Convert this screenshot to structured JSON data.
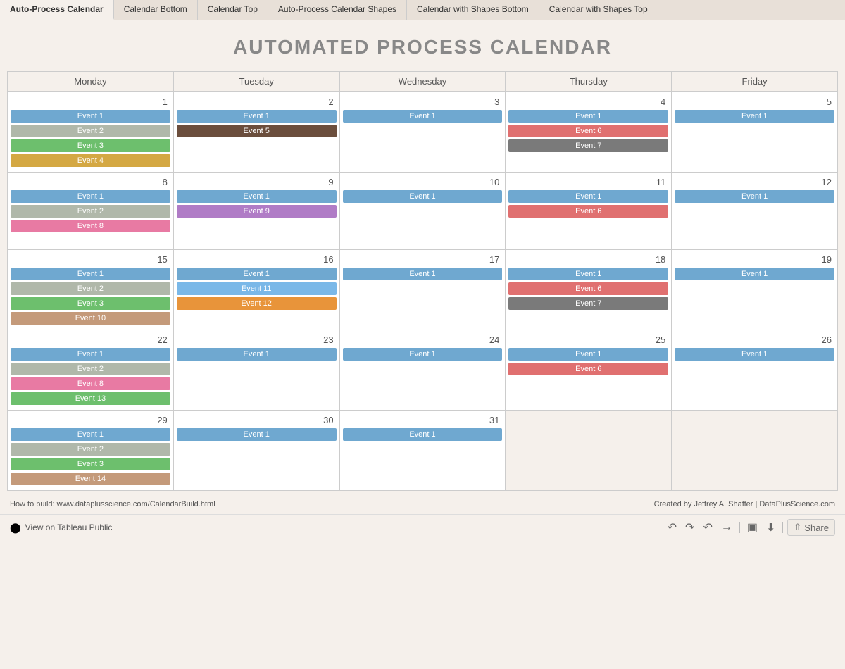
{
  "tabs": [
    {
      "label": "Auto-Process Calendar",
      "active": true
    },
    {
      "label": "Calendar Bottom",
      "active": false
    },
    {
      "label": "Calendar Top",
      "active": false
    },
    {
      "label": "Auto-Process Calendar Shapes",
      "active": false
    },
    {
      "label": "Calendar with Shapes Bottom",
      "active": false
    },
    {
      "label": "Calendar with Shapes Top",
      "active": false
    }
  ],
  "title": "AUTOMATED PROCESS CALENDAR",
  "day_headers": [
    "Monday",
    "Tuesday",
    "Wednesday",
    "Thursday",
    "Friday"
  ],
  "weeks": [
    {
      "days": [
        {
          "number": 1,
          "events": [
            {
              "label": "Event 1",
              "color": "#6fa8d0"
            },
            {
              "label": "Event 2",
              "color": "#b0b8aa"
            },
            {
              "label": "Event 3",
              "color": "#6dbf6d"
            },
            {
              "label": "Event 4",
              "color": "#d4a843"
            }
          ]
        },
        {
          "number": 2,
          "events": [
            {
              "label": "Event 1",
              "color": "#6fa8d0"
            },
            {
              "label": "Event 5",
              "color": "#6b4e3d"
            }
          ]
        },
        {
          "number": 3,
          "events": [
            {
              "label": "Event 1",
              "color": "#6fa8d0"
            }
          ]
        },
        {
          "number": 4,
          "events": [
            {
              "label": "Event 1",
              "color": "#6fa8d0"
            },
            {
              "label": "Event 6",
              "color": "#e07070"
            },
            {
              "label": "Event 7",
              "color": "#7a7a7a"
            }
          ]
        },
        {
          "number": 5,
          "events": [
            {
              "label": "Event 1",
              "color": "#6fa8d0"
            }
          ]
        }
      ]
    },
    {
      "days": [
        {
          "number": 8,
          "events": [
            {
              "label": "Event 1",
              "color": "#6fa8d0"
            },
            {
              "label": "Event 2",
              "color": "#b0b8aa"
            },
            {
              "label": "Event 8",
              "color": "#e87aa3"
            }
          ]
        },
        {
          "number": 9,
          "events": [
            {
              "label": "Event 1",
              "color": "#6fa8d0"
            },
            {
              "label": "Event 9",
              "color": "#b07cc6"
            }
          ]
        },
        {
          "number": 10,
          "events": [
            {
              "label": "Event 1",
              "color": "#6fa8d0"
            }
          ]
        },
        {
          "number": 11,
          "events": [
            {
              "label": "Event 1",
              "color": "#6fa8d0"
            },
            {
              "label": "Event 6",
              "color": "#e07070"
            }
          ]
        },
        {
          "number": 12,
          "events": [
            {
              "label": "Event 1",
              "color": "#6fa8d0"
            }
          ]
        }
      ]
    },
    {
      "days": [
        {
          "number": 15,
          "events": [
            {
              "label": "Event 1",
              "color": "#6fa8d0"
            },
            {
              "label": "Event 2",
              "color": "#b0b8aa"
            },
            {
              "label": "Event 3",
              "color": "#6dbf6d"
            },
            {
              "label": "Event 10",
              "color": "#c49a7a"
            }
          ]
        },
        {
          "number": 16,
          "events": [
            {
              "label": "Event 1",
              "color": "#6fa8d0"
            },
            {
              "label": "Event 11",
              "color": "#7ab8e8"
            },
            {
              "label": "Event 12",
              "color": "#e8943a"
            }
          ]
        },
        {
          "number": 17,
          "events": [
            {
              "label": "Event 1",
              "color": "#6fa8d0"
            }
          ]
        },
        {
          "number": 18,
          "events": [
            {
              "label": "Event 1",
              "color": "#6fa8d0"
            },
            {
              "label": "Event 6",
              "color": "#e07070"
            },
            {
              "label": "Event 7",
              "color": "#7a7a7a"
            }
          ]
        },
        {
          "number": 19,
          "events": [
            {
              "label": "Event 1",
              "color": "#6fa8d0"
            }
          ]
        }
      ]
    },
    {
      "days": [
        {
          "number": 22,
          "events": [
            {
              "label": "Event 1",
              "color": "#6fa8d0"
            },
            {
              "label": "Event 2",
              "color": "#b0b8aa"
            },
            {
              "label": "Event 8",
              "color": "#e87aa3"
            },
            {
              "label": "Event 13",
              "color": "#6dbf6d"
            }
          ]
        },
        {
          "number": 23,
          "events": [
            {
              "label": "Event 1",
              "color": "#6fa8d0"
            }
          ]
        },
        {
          "number": 24,
          "events": [
            {
              "label": "Event 1",
              "color": "#6fa8d0"
            }
          ]
        },
        {
          "number": 25,
          "events": [
            {
              "label": "Event 1",
              "color": "#6fa8d0"
            },
            {
              "label": "Event 6",
              "color": "#e07070"
            }
          ]
        },
        {
          "number": 26,
          "events": [
            {
              "label": "Event 1",
              "color": "#6fa8d0"
            }
          ]
        }
      ]
    },
    {
      "days": [
        {
          "number": 29,
          "events": [
            {
              "label": "Event 1",
              "color": "#6fa8d0"
            },
            {
              "label": "Event 2",
              "color": "#b0b8aa"
            },
            {
              "label": "Event 3",
              "color": "#6dbf6d"
            },
            {
              "label": "Event 14",
              "color": "#c49a7a"
            }
          ]
        },
        {
          "number": 30,
          "events": [
            {
              "label": "Event 1",
              "color": "#6fa8d0"
            }
          ]
        },
        {
          "number": 31,
          "events": [
            {
              "label": "Event 1",
              "color": "#6fa8d0"
            }
          ]
        },
        {
          "number": null,
          "events": []
        },
        {
          "number": null,
          "events": []
        }
      ]
    }
  ],
  "footer": {
    "how_to_build": "How to build: www.dataplusscience.com/CalendarBuild.html",
    "created_by": "Created by Jeffrey A. Shaffer | DataPlusScience.com"
  },
  "toolbar": {
    "undo": "↺",
    "redo": "↻",
    "back": "↺",
    "forward": "→",
    "fullscreen": "⛶",
    "download": "⬇",
    "share": "Share"
  },
  "view_public_label": "View on Tableau Public"
}
